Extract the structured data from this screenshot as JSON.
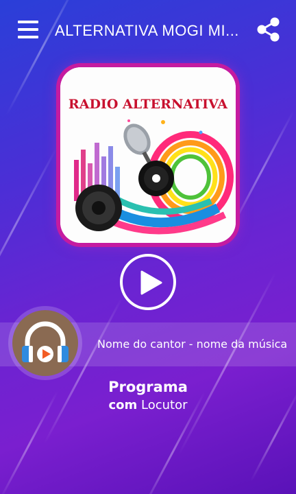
{
  "app": {
    "title": "ALTERNATIVA MOGI MI...",
    "menu_icon": "hamburger-menu-icon",
    "share_icon": "share-icon"
  },
  "cover": {
    "station_label": "RADIO ALTERNATIVA"
  },
  "player": {
    "play_icon": "play-icon",
    "now_playing": "Nome do cantor - nome da música",
    "avatar_icon": "headphones-play-icon"
  },
  "program": {
    "title": "Programa",
    "with_label": "com",
    "host": "Locutor"
  },
  "colors": {
    "accent_border": "#c51ba0",
    "avatar_bg": "#8a6a52",
    "headphone_blue": "#2f8be0",
    "play_orange": "#f25c24"
  }
}
